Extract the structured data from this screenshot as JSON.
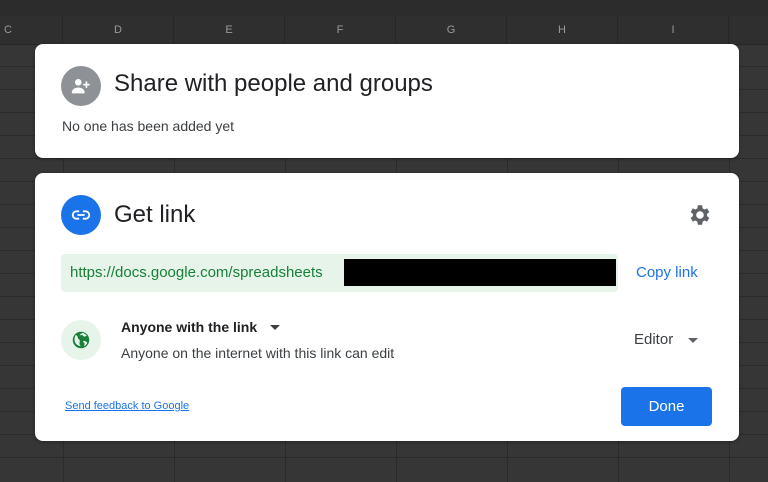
{
  "spreadsheet": {
    "columns": [
      "C",
      "D",
      "E",
      "F",
      "G",
      "H",
      "I"
    ]
  },
  "share_section": {
    "title": "Share with people and groups",
    "status": "No one has been added yet",
    "icon": "person-add-icon"
  },
  "link_section": {
    "title": "Get link",
    "icon": "link-icon",
    "settings_icon": "gear-icon",
    "url_visible": "https://docs.google.com/spreadsheets",
    "url_redacted": true,
    "copy_label": "Copy link",
    "access": {
      "label": "Anyone with the link",
      "description": "Anyone on the internet with this link can edit",
      "icon": "globe-icon"
    },
    "role": "Editor",
    "feedback_label": "Send feedback to Google",
    "done_label": "Done"
  },
  "colors": {
    "accent": "#1a73e8",
    "link_green": "#188038",
    "link_bg": "#e6f4ea",
    "share_icon_bg": "#8e9296"
  }
}
